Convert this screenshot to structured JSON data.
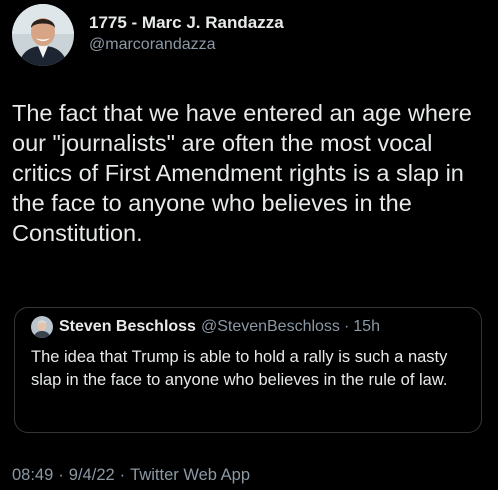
{
  "author": {
    "display_name": "1775 - Marc J. Randazza",
    "handle": "@marcorandazza",
    "avatar_icon": "profile-photo"
  },
  "tweet": {
    "text": "The fact that we have entered an age where our \"journalists\" are often the most vocal critics of First Amendment rights is a slap in the face to anyone who believes in the Constitution."
  },
  "quoted_tweet": {
    "display_name": "Steven Beschloss",
    "handle": "@StevenBeschloss",
    "separator": "·",
    "time": "15h",
    "text": "The idea that Trump is able to hold a rally is such a nasty slap in the face to anyone who believes in the rule of law.",
    "avatar_icon": "profile-photo"
  },
  "meta": {
    "time": "08:49",
    "separator1": "·",
    "date": "9/4/22",
    "separator2": "·",
    "source": "Twitter Web App"
  },
  "colors": {
    "background": "#000000",
    "text_primary": "#e7e9ea",
    "text_secondary": "#8b98a5",
    "border": "#333638"
  }
}
